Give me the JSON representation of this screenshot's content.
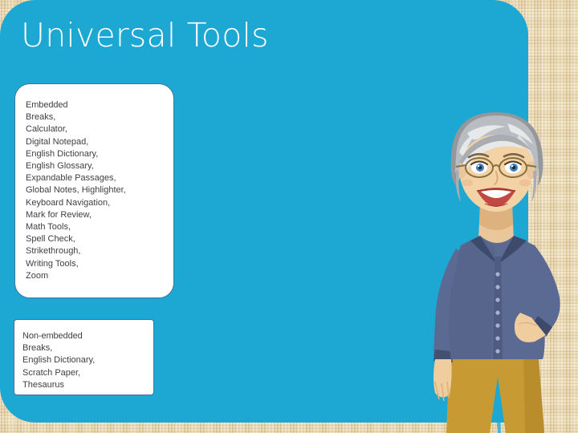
{
  "slide": {
    "title": "Universal Tools",
    "accent_color": "#1ca8d3",
    "background_color": "#e9d7ab",
    "text_color": "#3f3f3f",
    "box_border_color": "#44719f",
    "title_color": "#ffffff"
  },
  "embedded_box": {
    "heading": "Embedded",
    "items": [
      "Breaks,",
      "Calculator,",
      "Digital Notepad,",
      "English Dictionary,",
      "English Glossary,",
      "Expandable Passages,",
      "Global Notes, Highlighter,",
      "Keyboard Navigation,",
      "Mark for Review,",
      "Math Tools,",
      "Spell Check,",
      "Strikethrough,",
      "Writing Tools,",
      "Zoom"
    ]
  },
  "nonembedded_box": {
    "heading": "Non-embedded",
    "items": [
      "Breaks,",
      "English Dictionary,",
      "Scratch Paper,",
      "Thesaurus"
    ]
  },
  "illustration": {
    "name": "woman-with-glasses-illustration",
    "hair_color": "#b9bcc0",
    "hair_shadow": "#94979c",
    "hair_highlight": "#e6e8ea",
    "skin_color": "#f3d3a6",
    "skin_shadow": "#e0bb8b",
    "shirt_color": "#5b6a92",
    "shirt_shadow": "#445071",
    "pants_color": "#c89a33",
    "lips_color": "#c04a43",
    "eye_color": "#3d7fc1",
    "glasses_color": "#8a6f3c"
  }
}
